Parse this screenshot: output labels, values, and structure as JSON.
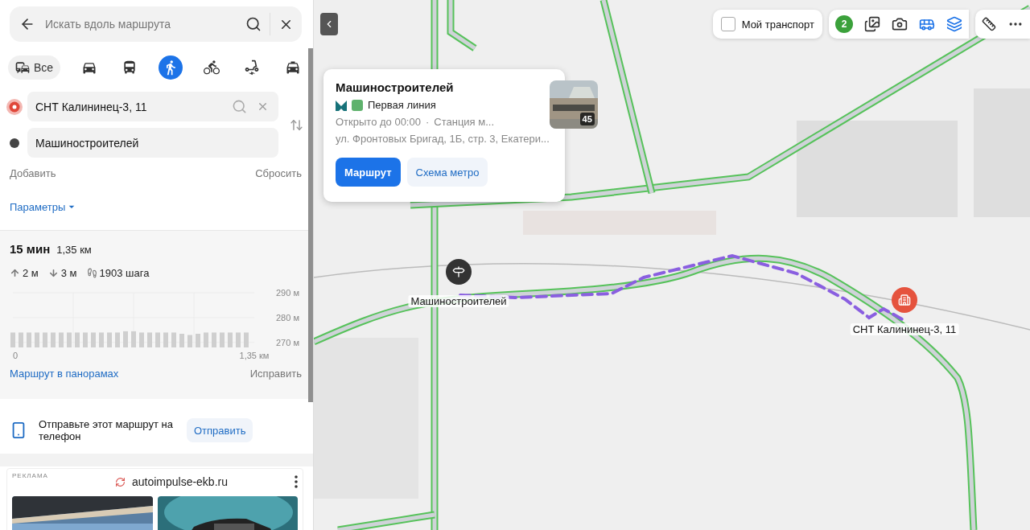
{
  "search": {
    "placeholder": "Искать вдоль маршрута"
  },
  "modes": [
    {
      "kind": "all",
      "label": "Все",
      "selected": false
    },
    {
      "kind": "car",
      "selected": false
    },
    {
      "kind": "bus",
      "selected": false
    },
    {
      "kind": "walk",
      "selected": true
    },
    {
      "kind": "bike",
      "selected": false
    },
    {
      "kind": "scooter",
      "selected": false
    },
    {
      "kind": "taxi",
      "selected": false
    }
  ],
  "waypoints": [
    {
      "kind": "origin",
      "value": "СНТ Калининец-3, 11"
    },
    {
      "kind": "destination",
      "value": "Машиностроителей"
    }
  ],
  "add_label": "Добавить",
  "reset_label": "Сбросить",
  "params_label": "Параметры",
  "route": {
    "time": "15 мин",
    "distance": "1,35 км",
    "ascent": "2 м",
    "descent": "3 м",
    "steps": "1903 шага",
    "chart_data": {
      "type": "bar",
      "grid": true,
      "xlim": [
        0,
        1.35
      ],
      "ylim": [
        268,
        290
      ],
      "x": [
        0,
        0.045,
        0.09,
        0.135,
        0.18,
        0.225,
        0.27,
        0.315,
        0.36,
        0.405,
        0.45,
        0.495,
        0.54,
        0.585,
        0.63,
        0.675,
        0.72,
        0.765,
        0.81,
        0.855,
        0.9,
        0.945,
        0.99,
        1.035,
        1.08,
        1.125,
        1.17,
        1.215,
        1.26,
        1.305
      ],
      "values": [
        274,
        274,
        274,
        274,
        274,
        274,
        274,
        274,
        274,
        274,
        274,
        274,
        274,
        274,
        274.5,
        274.5,
        274,
        274,
        274,
        274,
        274,
        273.5,
        273,
        273.5,
        274,
        274,
        274,
        274,
        274,
        274
      ],
      "xticks": [
        {
          "value": 0,
          "label": "0"
        },
        {
          "value": 1.35,
          "label": "1,35 км"
        }
      ],
      "yticks": [
        {
          "value": 270,
          "label": "270 м"
        },
        {
          "value": 280,
          "label": "280 м"
        },
        {
          "value": 290,
          "label": "290 м"
        }
      ]
    },
    "panorama_link": "Маршрут в панорамах",
    "fix_link": "Исправить"
  },
  "send": {
    "text": "Отправьте этот маршрут на телефон",
    "button": "Отправить"
  },
  "ad": {
    "label": "РЕКЛАМА",
    "domain": "autoimpulse-ekb.ru"
  },
  "popup": {
    "title": "Машиностроителей",
    "line": "Первая линия",
    "hours": "Открыто до 00:00",
    "separator": "·",
    "category": "Станция м...",
    "address": "ул. Фронтовых Бригад, 1Б, стр. 3, Екатери...",
    "photo_count": "45",
    "buttons": [
      {
        "kind": "primary",
        "label": "Маршрут"
      },
      {
        "kind": "secondary",
        "label": "Схема метро"
      }
    ]
  },
  "toolbar": {
    "my_transport": {
      "label": "Мой транспорт",
      "checked": false
    },
    "traffic_score": "2"
  },
  "markers": [
    {
      "kind": "destination",
      "label": "Машиностроителей"
    },
    {
      "kind": "origin",
      "label": "СНТ Калининец-3, 11"
    }
  ]
}
